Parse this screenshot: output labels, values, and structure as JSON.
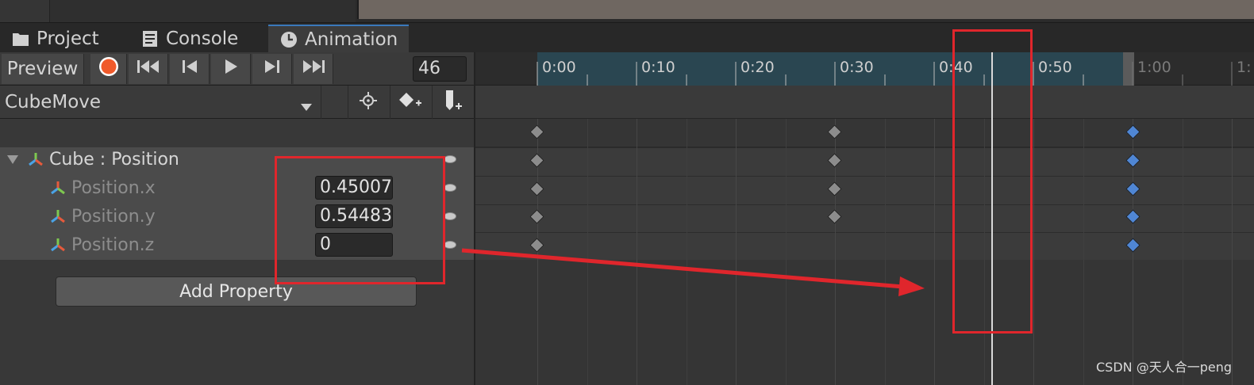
{
  "tabs": [
    {
      "label": "Project",
      "icon": "folder-icon"
    },
    {
      "label": "Console",
      "icon": "console-icon"
    },
    {
      "label": "Animation",
      "icon": "clock-icon",
      "active": true
    }
  ],
  "toolbar": {
    "preview_label": "Preview",
    "record_icon": "record-icon",
    "first_key_icon": "first-keyframe-icon",
    "prev_key_icon": "previous-keyframe-icon",
    "play_icon": "play-icon",
    "next_key_icon": "next-keyframe-icon",
    "last_key_icon": "last-keyframe-icon",
    "frame_value": "46"
  },
  "clip": {
    "name": "CubeMove",
    "add_keyframe_icon": "add-keyframe-icon",
    "add_event_icon": "add-event-icon",
    "filter_icon": "crosshair-icon"
  },
  "properties": {
    "group_label": "Cube : Position",
    "rows": [
      {
        "label": "Position.x",
        "value": "0.45007"
      },
      {
        "label": "Position.y",
        "value": "0.54483"
      },
      {
        "label": "Position.z",
        "value": "0"
      }
    ],
    "add_property_label": "Add Property"
  },
  "ruler": {
    "labels": [
      "0:00",
      "0:10",
      "0:20",
      "0:30",
      "0:40",
      "0:50",
      "1:00",
      "1:"
    ]
  },
  "colors": {
    "accent_tab": "#3a79bb",
    "record": "#f05a2b",
    "selected_key": "#4f86d4",
    "annotation": "#e0262c"
  },
  "watermark": "CSDN @天人合一peng"
}
